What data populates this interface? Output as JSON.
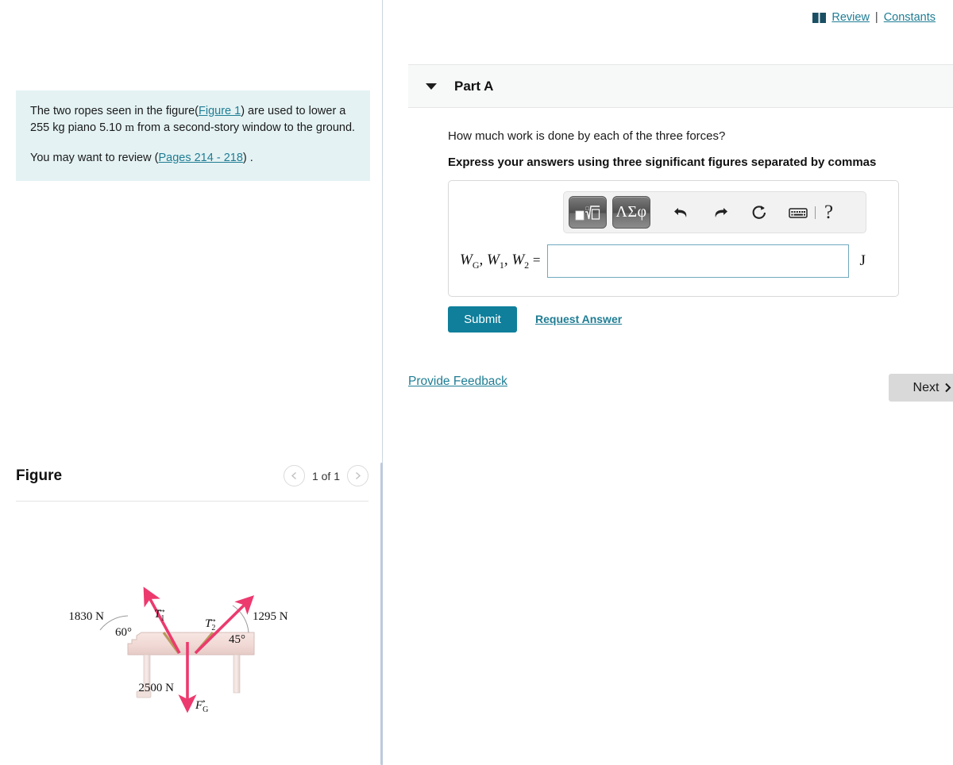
{
  "header": {
    "book_icon": "book-icon",
    "review_label": "Review",
    "separator": "|",
    "constants_label": "Constants"
  },
  "problem": {
    "text_before_link": "The two ropes seen in the figure(",
    "figure_link": "Figure 1",
    "text_after_link": ") are used to lower a 255 kg piano 5.10 ",
    "unit_m": "m",
    "text_end": " from a second-story window to the ground.",
    "review_prefix": "You may want to review (",
    "review_link": "Pages 214 - 218",
    "review_suffix": ") ."
  },
  "figure": {
    "title": "Figure",
    "prev_icon": "chevron-left-icon",
    "next_icon": "chevron-right-icon",
    "page_label": "1 of 1",
    "diagram": {
      "t1_force_label": "1830 N",
      "t1_vector_label": "T⃗1",
      "t1_angle": "60°",
      "t2_force_label": "1295 N",
      "t2_vector_label": "T⃗2",
      "t2_angle": "45°",
      "weight_label": "2500 N",
      "weight_vector_label": "F⃗G",
      "arrow_color": "#ec3a6e",
      "rope_color": "#b79a5c",
      "piano_color": "#f3dcd9"
    }
  },
  "part": {
    "caret_icon": "caret-down-icon",
    "title": "Part A",
    "question": "How much work is done by each of the three forces?",
    "instruction": "Express your answers using three significant figures separated by commas"
  },
  "answer": {
    "toolbar": {
      "template_button": "math-template-icon",
      "greek_button": "ΛΣφ",
      "undo_icon": "undo-icon",
      "redo_icon": "redo-icon",
      "reset_icon": "reset-icon",
      "keyboard_icon": "keyboard-icon",
      "help_label": "?"
    },
    "label_w": "W",
    "label_sub_g": "G",
    "label_sub_1": "1",
    "label_sub_2": "2",
    "equals": "=",
    "value": "",
    "placeholder": "",
    "unit": "J"
  },
  "actions": {
    "submit_label": "Submit",
    "request_answer_label": "Request Answer",
    "provide_feedback_label": "Provide Feedback",
    "next_label": "Next",
    "next_icon": "chevron-right-icon"
  },
  "colors": {
    "accent_teal": "#0f7f9b",
    "link_teal": "#1f7d94",
    "intro_bg": "#e4f2f3"
  }
}
